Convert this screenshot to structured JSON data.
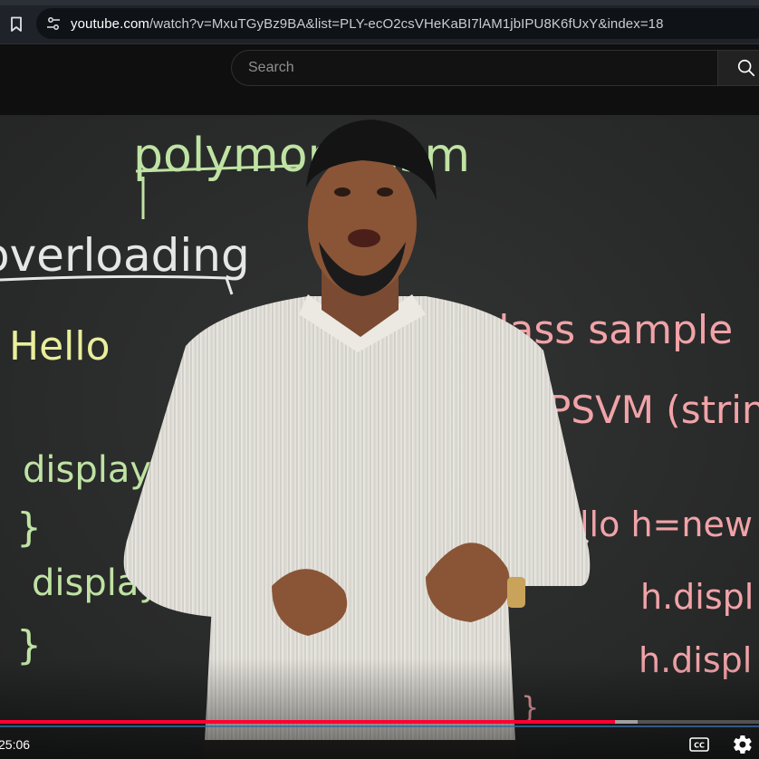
{
  "browser": {
    "url_domain": "youtube.com",
    "url_path": "/watch?v=MxuTGyBz9BA&list=PLY-ecO2csVHeKaBI7lAM1jbIPU8K6fUxY&index=18",
    "icons": [
      "bookmark-icon",
      "site-settings-icon"
    ]
  },
  "header": {
    "search_placeholder": "Search",
    "search_icon": "search-icon"
  },
  "video": {
    "chalkboard_text": {
      "top": "polymorphism",
      "overloading": "overloading",
      "hello": "Hello",
      "display1": "display",
      "brace1": "}",
      "display2": "display",
      "brace2": "}",
      "class_sample": "class sample",
      "psvm": "PSVM (strin",
      "hello_new": "llo  h=new",
      "h_display1": "h.displ",
      "h_display2": "h.displ",
      "brace3": "}"
    },
    "player": {
      "current_time": "25:06",
      "progress_played": 0.81,
      "progress_buffered": 0.84,
      "icons": [
        "cc-icon",
        "settings-gear-icon"
      ]
    },
    "colors": {
      "board": "#2a2b2b",
      "chalk_green": "#bfe3a3",
      "chalk_yellow": "#e9ee9a",
      "chalk_pink": "#f1a3a8",
      "chalk_white": "#e6e6e6",
      "progress_red": "#ff0033"
    }
  }
}
